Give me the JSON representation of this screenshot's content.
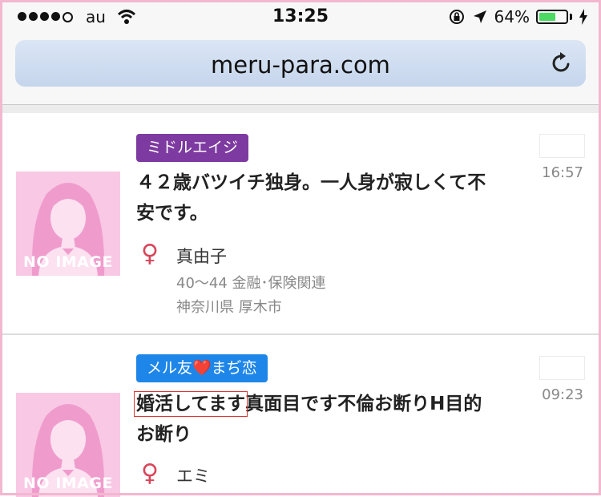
{
  "status_bar": {
    "carrier": "au",
    "time": "13:25",
    "battery": "64%",
    "battery_level": 0.64
  },
  "browser": {
    "url": "meru-para.com"
  },
  "posts": [
    {
      "tag": "ミドルエイジ",
      "title": "４２歳バツイチ独身。一人身が寂しくて不安です。",
      "name": "真由子",
      "detail1": "40～44 金融･保険関連",
      "detail2": "神奈川県 厚木市",
      "time": "16:57",
      "thumbnail_text": "NO IMAGE",
      "gender_icon": "♀"
    },
    {
      "tag": "メル友❤️まぢ恋",
      "title_highlight": "婚活してます",
      "title_rest": "真面目です不倫お断りH目的お断り",
      "name": "エミ",
      "time": "09:23",
      "thumbnail_text": "NO IMAGE",
      "gender_icon": "♀"
    }
  ]
}
